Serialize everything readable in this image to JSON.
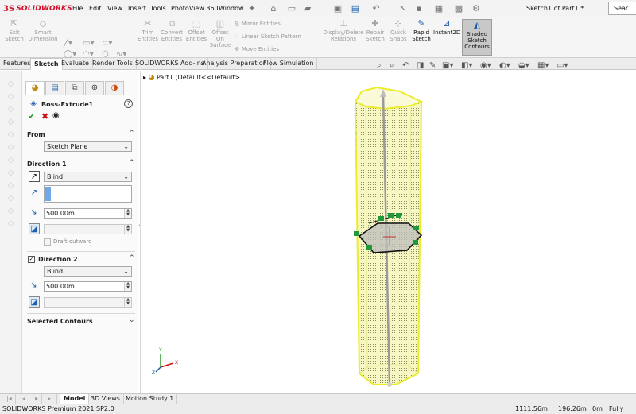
{
  "titlebar": {
    "logo_ds": "3S",
    "logo_text": "SOLIDWORKS",
    "menus": [
      "File",
      "Edit",
      "View",
      "Insert",
      "Tools",
      "PhotoView 360",
      "Window"
    ],
    "document_title": "Sketch1 of Part1 *",
    "search_label": "Sear"
  },
  "ribbon": {
    "exit_sketch": [
      "Exit",
      "Sketch"
    ],
    "smart_dimension": [
      "Smart",
      "Dimension"
    ],
    "trim_entities": [
      "Trim",
      "Entities"
    ],
    "convert_entities": [
      "Convert",
      "Entities"
    ],
    "offset_entities": [
      "Offset",
      "Entities"
    ],
    "offset_on_surface": [
      "Offset",
      "On",
      "Surface"
    ],
    "mirror_entities": "Mirror Entities",
    "linear_sketch_pattern": "Linear Sketch Pattern",
    "move_entities": "Move Entities",
    "display_delete_relations": [
      "Display/Delete",
      "Relations"
    ],
    "repair_sketch": [
      "Repair",
      "Sketch"
    ],
    "quick_snaps": [
      "Quick",
      "Snaps"
    ],
    "rapid_sketch": [
      "Rapid",
      "Sketch"
    ],
    "instant2d": "Instant2D",
    "shaded_sketch_contours": [
      "Shaded",
      "Sketch",
      "Contours"
    ]
  },
  "tabs": [
    "Features",
    "Sketch",
    "Evaluate",
    "Render Tools",
    "SOLIDWORKS Add-Ins",
    "Analysis Preparation",
    "Flow Simulation"
  ],
  "active_tab": "Sketch",
  "property_manager": {
    "feature_name": "Boss-Extrude1",
    "help": "?",
    "from": {
      "title": "From",
      "value": "Sketch Plane"
    },
    "direction1": {
      "title": "Direction 1",
      "end_condition": "Blind",
      "depth": "500.00m",
      "draft_outward": "Draft outward"
    },
    "direction2": {
      "title": "Direction 2",
      "checked": true,
      "end_condition": "Blind",
      "depth": "500.00m"
    },
    "selected_contours": "Selected Contours"
  },
  "tree": {
    "item": "Part1",
    "config": "(Default<<Default>..."
  },
  "triad": {
    "x": "X",
    "y": "Y",
    "z": "Z"
  },
  "bottom_tabs": [
    "Model",
    "3D Views",
    "Motion Study 1"
  ],
  "active_bottom_tab": "Model",
  "status": {
    "app": "SOLIDWORKS Premium 2021 SP2.0",
    "coord_x": "1111.56m",
    "coord_y": "196.26m",
    "coord_z": "0m",
    "state": "Fully Defin"
  },
  "colors": {
    "logo_red": "#d0102a",
    "preview_yellow": "#ecec2a",
    "relation_green": "#1f9a3a",
    "accent_blue": "#1c5fae",
    "ok_green": "#2a9a2a",
    "cancel_red": "#cc1111"
  }
}
